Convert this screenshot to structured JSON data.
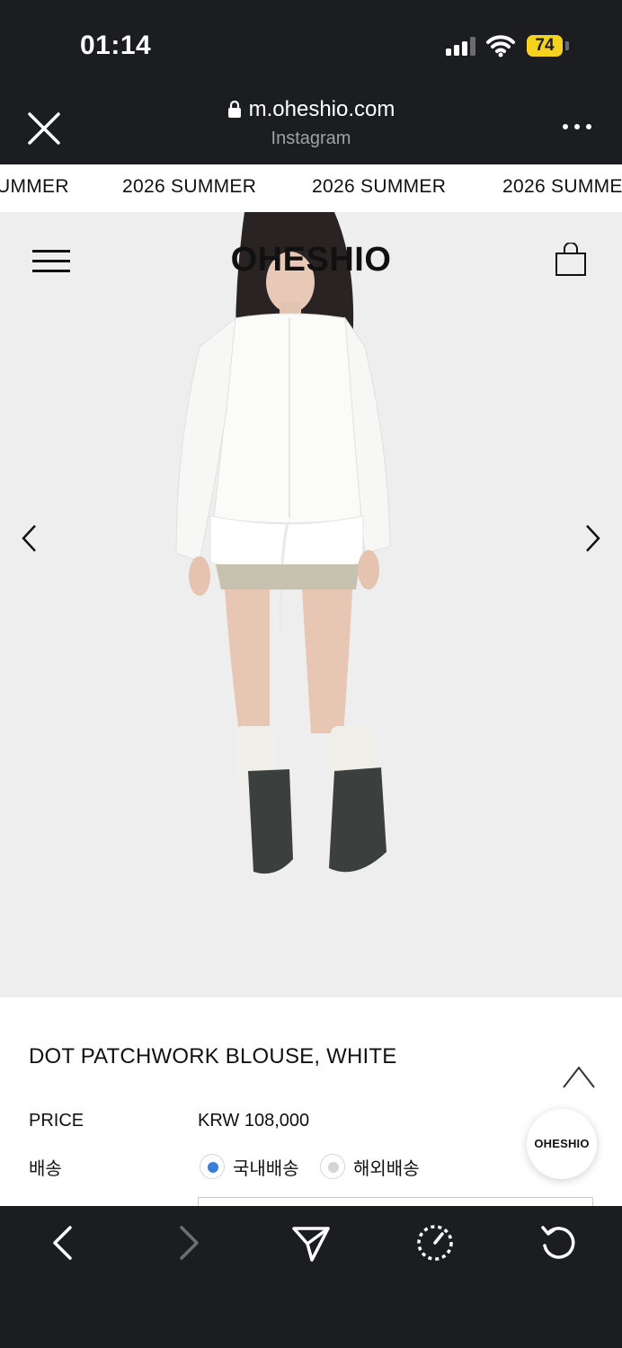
{
  "status_bar": {
    "time": "01:14",
    "battery": "74"
  },
  "browser": {
    "url": "m.oheshio.com",
    "source": "Instagram"
  },
  "marquee": {
    "items": [
      "UMMER",
      "2026 SUMMER",
      "2026 SUMMER",
      "2026 SUMME"
    ]
  },
  "site": {
    "logo": "OHESHIO"
  },
  "product": {
    "title": "DOT PATCHWORK BLOUSE, WHITE",
    "price_label": "PRICE",
    "price_value": "KRW 108,000",
    "shipping_label": "배송",
    "shipping_options": [
      {
        "label": "국내배송",
        "selected": true
      },
      {
        "label": "해외배송",
        "selected": false
      }
    ]
  },
  "floating_badge": "OHESHIO",
  "colors": {
    "bar_bg": "#1c1d20",
    "battery": "#f4d21f",
    "radio_selected": "#3b7ddd",
    "hero_bg": "#eeeeee"
  },
  "icons": {
    "browser": [
      "close-icon",
      "lock-icon",
      "more-icon"
    ],
    "site": [
      "hamburger-menu-icon",
      "shopping-bag-icon",
      "chevron-left-icon",
      "chevron-right-icon",
      "chevron-up-icon"
    ],
    "toolbar": [
      "back-icon",
      "forward-icon",
      "share-icon",
      "speed-icon",
      "reload-icon"
    ]
  }
}
